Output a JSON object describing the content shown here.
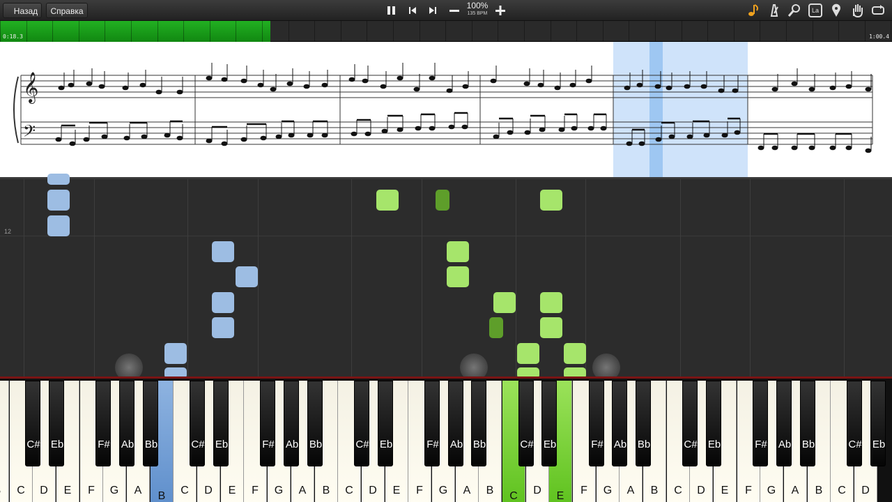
{
  "toolbar": {
    "back_label": "Назад",
    "help_label": "Справка",
    "zoom": "100%",
    "bpm": "135 BPM",
    "icons": [
      "pause-icon",
      "skip-back-icon",
      "skip-forward-icon",
      "minus-icon",
      "plus-icon",
      "note-icon",
      "metronome-icon",
      "magnifier-icon",
      "la-icon",
      "map-pin-icon",
      "hand-icon",
      "loop-icon"
    ],
    "la_text": "La"
  },
  "progress": {
    "current_time": "0:18.3",
    "total_time": "1:00.4",
    "fraction": 0.303
  },
  "roll": {
    "measure_number": "12"
  },
  "keyboard": {
    "white_keys": [
      "B",
      "C",
      "D",
      "E",
      "F",
      "G",
      "A",
      "B",
      "C",
      "D",
      "E",
      "F",
      "G",
      "A",
      "B",
      "C",
      "D",
      "E",
      "F",
      "G",
      "A",
      "B",
      "C",
      "D",
      "E",
      "F",
      "G",
      "A",
      "B",
      "C",
      "D",
      "E",
      "F",
      "G",
      "A",
      "B",
      "C",
      "D"
    ],
    "black_keys": [
      "Bb",
      "C#",
      "Eb",
      "F#",
      "Ab",
      "Bb",
      "C#",
      "Eb",
      "F#",
      "Ab",
      "Bb",
      "C#",
      "Eb",
      "F#",
      "Ab",
      "Bb",
      "C#",
      "Eb",
      "F#",
      "Ab",
      "Bb",
      "C#",
      "Eb",
      "F#",
      "Ab",
      "Bb",
      "C#",
      "Eb"
    ]
  },
  "colors": {
    "left_hand": "#9dbde3",
    "right_hand": "#a6e56b",
    "progress": "#22b022"
  }
}
